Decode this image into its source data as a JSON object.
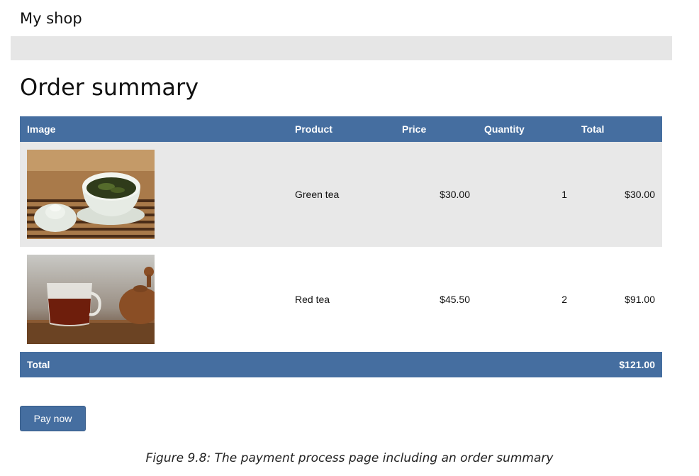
{
  "header": {
    "shop_title": "My shop"
  },
  "page": {
    "title": "Order summary"
  },
  "table": {
    "columns": {
      "image": "Image",
      "product": "Product",
      "price": "Price",
      "quantity": "Quantity",
      "total": "Total"
    },
    "rows": [
      {
        "image_icon": "green-tea-photo",
        "product": "Green tea",
        "price": "$30.00",
        "quantity": "1",
        "total": "$30.00"
      },
      {
        "image_icon": "red-tea-photo",
        "product": "Red tea",
        "price": "$45.50",
        "quantity": "2",
        "total": "$91.00"
      }
    ],
    "footer": {
      "label": "Total",
      "amount": "$121.00"
    }
  },
  "actions": {
    "pay_label": "Pay now"
  },
  "caption": "Figure 9.8: The payment process page including an order summary",
  "colors": {
    "accent": "#456ea0",
    "nav_bar": "#e6e6e6",
    "row_alt": "#e8e8e8"
  }
}
